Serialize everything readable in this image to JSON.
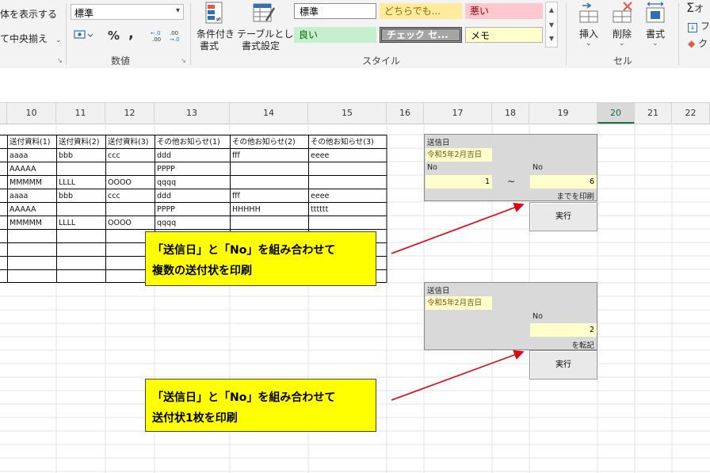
{
  "ribbon": {
    "show_all_text": "体を表示する",
    "merge_center": "て中央揃え",
    "number_format": "標準",
    "number_group": "数値",
    "style_group": "スタイル",
    "cells_group": "セル",
    "conditional_format_line1": "条件付き",
    "conditional_format_line2": "書式",
    "format_as_table_line1": "テーブルとして",
    "format_as_table_line2": "書式設定",
    "cell_styles": [
      "標準",
      "どちらでも...",
      "悪い",
      "良い",
      "チェック セ...",
      "メモ"
    ],
    "insert": "挿入",
    "delete": "削除",
    "format": "書式",
    "percent": "%",
    "comma": ",",
    "dec_inc": "←.0 .00",
    "dec_dec": ".00 →.0",
    "sum_partial": "オ",
    "fill_partial": "フ",
    "clear_partial": "ク"
  },
  "columns": [
    "10",
    "11",
    "12",
    "13",
    "14",
    "15",
    "16",
    "17",
    "18",
    "19",
    "20",
    "21",
    "22"
  ],
  "table": {
    "headers": [
      "送付資料(1)",
      "送付資料(2)",
      "送付資料(3)",
      "その他お知らせ(1)",
      "その他お知らせ(2)",
      "その他お知らせ(3)"
    ],
    "rows": [
      [
        "aaaa",
        "bbb",
        "ccc",
        "ddd",
        "fff",
        "eeee"
      ],
      [
        "AAAAA",
        "",
        "",
        "PPPP",
        "",
        ""
      ],
      [
        "MMMMM",
        "LLLL",
        "OOOO",
        "qqqq",
        "",
        ""
      ],
      [
        "aaaa",
        "bbb",
        "ccc",
        "ddd",
        "fff",
        "eeee"
      ],
      [
        "AAAAA",
        "",
        "",
        "PPPP",
        "HHHHH",
        "tttttt"
      ],
      [
        "MMMMM",
        "LLLL",
        "OOOO",
        "qqqq",
        "",
        ""
      ],
      [
        "",
        "",
        "",
        "",
        "",
        ""
      ],
      [
        "",
        "",
        "",
        "",
        "",
        ""
      ],
      [
        "",
        "",
        "",
        "",
        "",
        ""
      ],
      [
        "",
        "",
        "",
        "",
        "",
        ""
      ]
    ]
  },
  "panel1": {
    "send_date_label": "送信日",
    "send_date_value": "令和5年2月吉日",
    "no_from_label": "No",
    "no_to_label": "No",
    "no_from_value": "1",
    "tilde": "~",
    "no_to_value": "6",
    "suffix": "までを印刷",
    "execute": "実行"
  },
  "panel2": {
    "send_date_label": "送信日",
    "send_date_value": "令和5年2月吉日",
    "no_label": "No",
    "no_value": "2",
    "suffix": "を転記",
    "execute": "実行"
  },
  "callout1": {
    "line1": "「送信日」と「No」を組み合わせて",
    "line2": "複数の送付状を印刷"
  },
  "callout2": {
    "line1": "「送信日」と「No」を組み合わせて",
    "line2": "送付状1枚を印刷"
  },
  "colors": {
    "arrow": "#e3000f",
    "callout": "#ffff00",
    "input": "#ffffcc",
    "panel": "#d9d9d9",
    "style_bad": "#ffc7ce",
    "style_good": "#c6efce",
    "style_neutral": "#ffeb9c",
    "style_check": "#a5a5a5",
    "style_memo": "#ffffcc"
  }
}
